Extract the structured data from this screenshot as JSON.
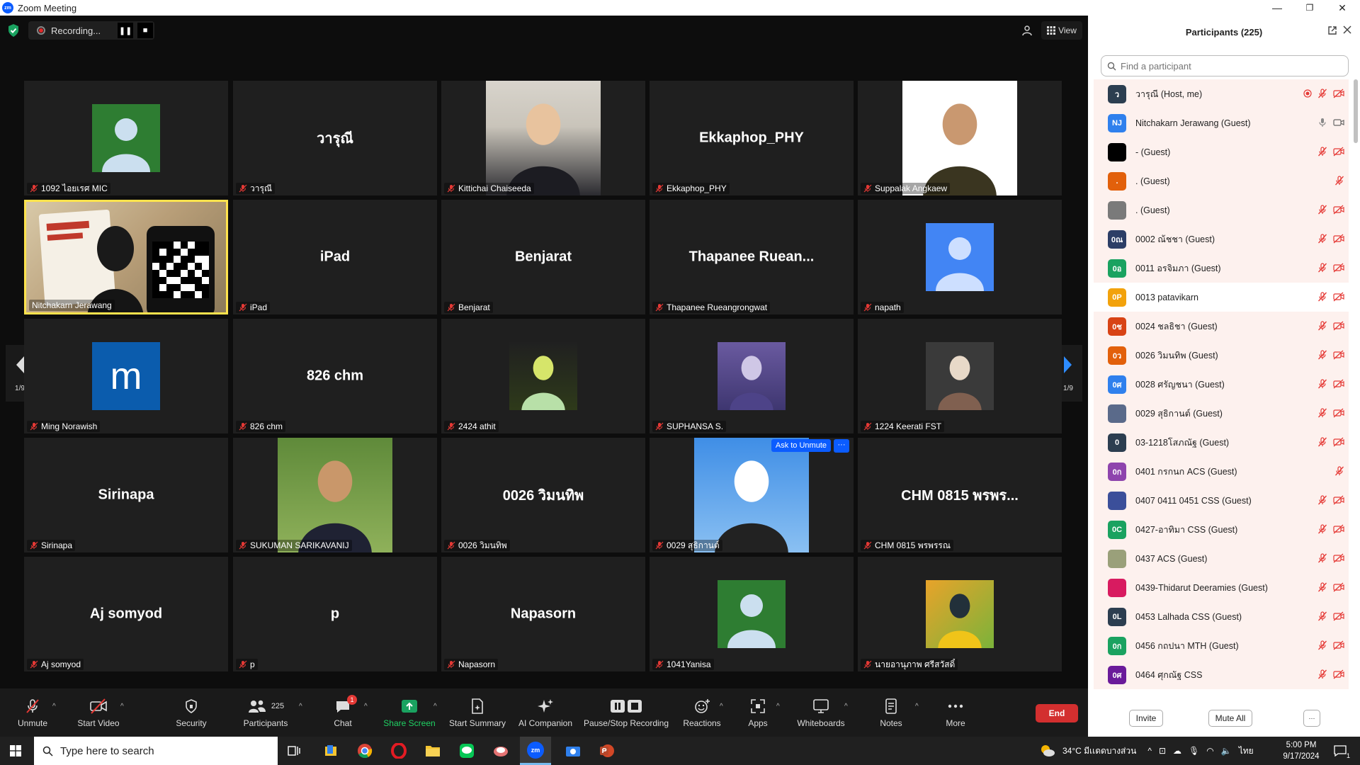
{
  "window": {
    "title": "Zoom Meeting",
    "minimize": "—",
    "restore": "❐",
    "close": "✕"
  },
  "topbar": {
    "recording_label": "Recording...",
    "pause_glyph": "❚❚",
    "stop_glyph": "■",
    "view_label": "View"
  },
  "pager": {
    "left": "1/9",
    "right": "1/9"
  },
  "tiles": [
    {
      "label": "1092 ไอยเรศ MIC",
      "type": "avatar",
      "avatar_color": "#2e7d32"
    },
    {
      "label": "วารุณี",
      "type": "name",
      "display": "วารุณี"
    },
    {
      "label": "Kittichai Chaiseeda",
      "type": "photo"
    },
    {
      "label": "Ekkaphop_PHY",
      "type": "name",
      "display": "Ekkaphop_PHY"
    },
    {
      "label": "Suppalak Angkaew",
      "type": "photo"
    },
    {
      "label": "Nitchakarn Jerawang",
      "type": "video"
    },
    {
      "label": "iPad",
      "type": "name",
      "display": "iPad"
    },
    {
      "label": "Benjarat",
      "type": "name",
      "display": "Benjarat"
    },
    {
      "label": "Thapanee Rueangrongwat",
      "type": "name",
      "display": "Thapanee  Ruean..."
    },
    {
      "label": "napath",
      "type": "avatar",
      "avatar_color": "#4285f4"
    },
    {
      "label": "Ming Norawish",
      "type": "letter",
      "letter": "m",
      "avatar_color": "#0b5cad"
    },
    {
      "label": "826 chm",
      "type": "name",
      "display": "826 chm"
    },
    {
      "label": "2424 athit",
      "type": "photo"
    },
    {
      "label": "SUPHANSA S.",
      "type": "photo"
    },
    {
      "label": "1224 Keerati FST",
      "type": "photo"
    },
    {
      "label": "Sirinapa",
      "type": "name",
      "display": "Sirinapa"
    },
    {
      "label": "SUKUMAN SARIKAVANIJ",
      "type": "photo"
    },
    {
      "label": "0026 วิมนทิพ",
      "type": "name",
      "display": "0026 วิมนทิพ"
    },
    {
      "label": "0029 สุธิกานต์",
      "type": "photo",
      "ask_unmute": "Ask to Unmute"
    },
    {
      "label": "CHM 0815 พรพรรณ",
      "type": "name",
      "display": "CHM 0815 พรพร..."
    },
    {
      "label": "Aj somyod",
      "type": "name",
      "display": "Aj somyod"
    },
    {
      "label": "p",
      "type": "name",
      "display": "p"
    },
    {
      "label": "Napasorn",
      "type": "name",
      "display": "Napasorn"
    },
    {
      "label": "1041Yanisa",
      "type": "avatar",
      "avatar_color": "#2e7d32"
    },
    {
      "label": "นายอานุภาพ ศรีสวัสดิ์",
      "type": "photo"
    }
  ],
  "toolbar": {
    "unmute": "Unmute",
    "start_video": "Start Video",
    "security": "Security",
    "participants": "Participants",
    "participants_count": "225",
    "chat": "Chat",
    "chat_badge": "1",
    "share_screen": "Share Screen",
    "start_summary": "Start Summary",
    "ai_companion": "AI Companion",
    "pause_stop_recording": "Pause/Stop Recording",
    "reactions": "Reactions",
    "apps": "Apps",
    "whiteboards": "Whiteboards",
    "notes": "Notes",
    "more": "More",
    "end": "End"
  },
  "panel": {
    "title": "Participants (225)",
    "search_placeholder": "Find a participant",
    "invite": "Invite",
    "mute_all": "Mute All",
    "more": "···",
    "participants": [
      {
        "initials": "ว",
        "name": "วารุณี (Host, me)",
        "color": "#2c3e50",
        "rec": true
      },
      {
        "initials": "NJ",
        "name": "Nitchakarn Jerawang (Guest)",
        "color": "#2f80ed",
        "live": true
      },
      {
        "initials": "",
        "name": "- (Guest)",
        "color": "#000000"
      },
      {
        "initials": ".",
        "name": ". (Guest)",
        "color": "#e2600b",
        "mic_only": true
      },
      {
        "initials": "",
        "name": ". (Guest)",
        "color": "#7a7a7a"
      },
      {
        "initials": "0ณ",
        "name": "0002 ณ้ชชา (Guest)",
        "color": "#2c3e66"
      },
      {
        "initials": "0อ",
        "name": "0011 อรจิมภา (Guest)",
        "color": "#1aa260"
      },
      {
        "initials": "0P",
        "name": "0013 patavikarn",
        "color": "#f2a20c"
      },
      {
        "initials": "0ช",
        "name": "0024 ชลธิชา (Guest)",
        "color": "#d84315"
      },
      {
        "initials": "0ว",
        "name": "0026 วิมนทิพ (Guest)",
        "color": "#e2600b"
      },
      {
        "initials": "0ศ",
        "name": "0028 ศรัญชนา (Guest)",
        "color": "#2f80ed"
      },
      {
        "initials": "",
        "name": "0029 สุธิกานต์ (Guest)",
        "color": "#5a6a8a"
      },
      {
        "initials": "0",
        "name": "03-1218โสภณัฐ (Guest)",
        "color": "#2c3e50"
      },
      {
        "initials": "0ก",
        "name": "0401 กรกนก ACS (Guest)",
        "color": "#8e44ad",
        "mic_only": true
      },
      {
        "initials": "",
        "name": "0407 0411 0451 CSS (Guest)",
        "color": "#3b4f9a"
      },
      {
        "initials": "0C",
        "name": "0427-อาทิมา CSS (Guest)",
        "color": "#1aa260"
      },
      {
        "initials": "",
        "name": "0437 ACS (Guest)",
        "color": "#9aa07a"
      },
      {
        "initials": "",
        "name": "0439-Thidarut Deeramies (Guest)",
        "color": "#d81b60"
      },
      {
        "initials": "0L",
        "name": "0453 Lalhada CSS (Guest)",
        "color": "#2c3e50"
      },
      {
        "initials": "0ก",
        "name": "0456 กถปนา MTH (Guest)",
        "color": "#1aa260"
      },
      {
        "initials": "0ศ",
        "name": "0464 ศุกณัฐ CSS",
        "color": "#6a1b9a"
      }
    ]
  },
  "taskbar": {
    "search_placeholder": "Type here to search",
    "weather": "34°C มีเเดดบางส่วน",
    "lang": "ไทย",
    "time": "5:00 PM",
    "date": "9/17/2024",
    "notif_count": "1"
  }
}
